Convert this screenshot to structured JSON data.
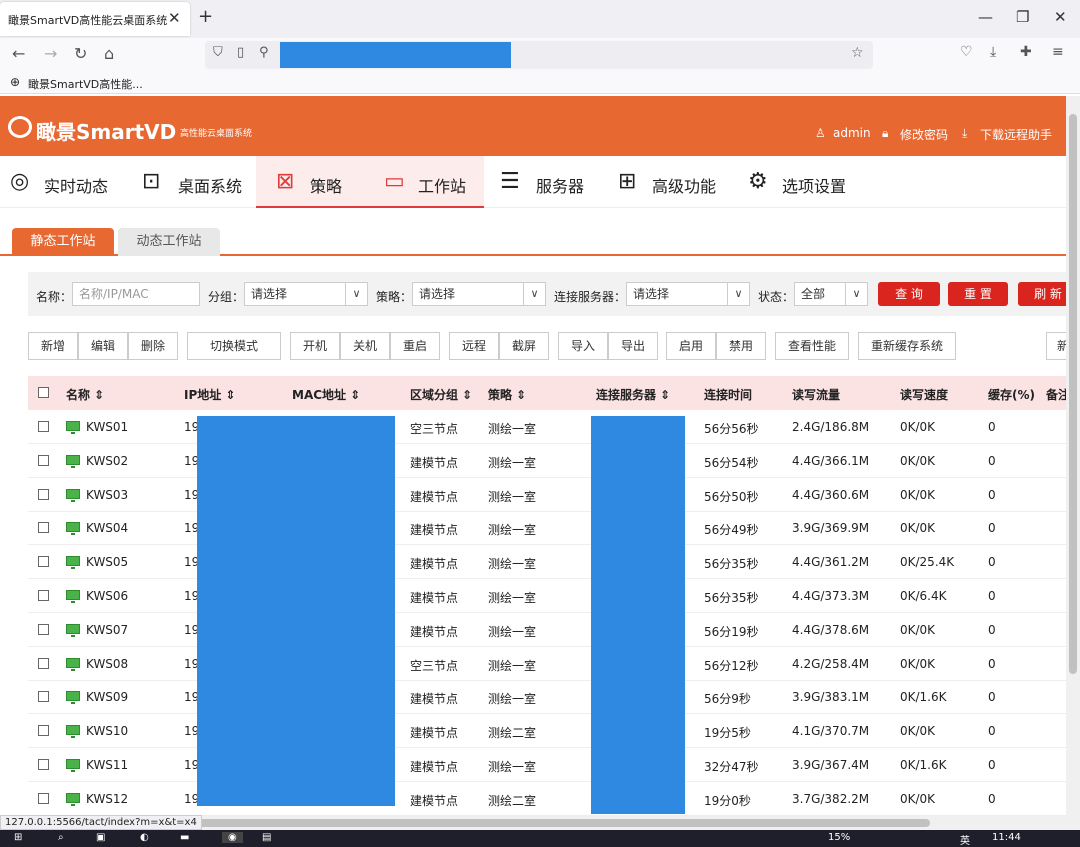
{
  "browser": {
    "tab_title": "瞰景SmartVD高性能云桌面系统",
    "tab_close": "✕",
    "new_tab": "+",
    "bookmark": "瞰景SmartVD高性能...",
    "status_url": "127.0.0.1:5566/tact/index?m=x&t=x4"
  },
  "header": {
    "logo": "瞰景SmartVD",
    "logo_sub": "高性能云桌面系统",
    "user": "admin",
    "change_password": "修改密码",
    "download": "下载远程助手"
  },
  "nav": [
    "实时动态",
    "桌面系统",
    "策略",
    "工作站",
    "服务器",
    "高级功能",
    "选项设置"
  ],
  "subtabs": [
    "静态工作站",
    "动态工作站"
  ],
  "filters": {
    "name_label": "名称：",
    "name_placeholder": "名称/IP/MAC",
    "group_label": "分组：",
    "group_value": "请选择",
    "policy_label": "策略：",
    "policy_value": "请选择",
    "server_label": "连接服务器：",
    "server_value": "请选择",
    "state_label": "状态：",
    "state_value": "全部",
    "query": "查 询",
    "reset": "重 置",
    "refresh": "刷 新"
  },
  "actions": [
    "新增",
    "编辑",
    "删除",
    "切换模式",
    "开机",
    "关机",
    "重启",
    "远程",
    "截屏",
    "导入",
    "导出",
    "启用",
    "禁用",
    "查看性能",
    "重新缓存系统",
    "新"
  ],
  "columns": [
    "名称 ⇕",
    "IP地址 ⇕",
    "MAC地址 ⇕",
    "区域分组 ⇕",
    "策略 ⇕",
    "连接服务器 ⇕",
    "连接时间",
    "读写流量",
    "读写速度",
    "缓存(%)",
    "备注"
  ],
  "rows": [
    {
      "name": "KWS01",
      "ip": "19",
      "group": "空三节点",
      "policy": "测绘一室",
      "time": "56分56秒",
      "traffic": "2.4G/186.8M",
      "speed": "0K/0K",
      "cache": "0"
    },
    {
      "name": "KWS02",
      "ip": "19",
      "group": "建模节点",
      "policy": "测绘一室",
      "time": "56分54秒",
      "traffic": "4.4G/366.1M",
      "speed": "0K/0K",
      "cache": "0"
    },
    {
      "name": "KWS03",
      "ip": "19",
      "group": "建模节点",
      "policy": "测绘一室",
      "time": "56分50秒",
      "traffic": "4.4G/360.6M",
      "speed": "0K/0K",
      "cache": "0"
    },
    {
      "name": "KWS04",
      "ip": "19",
      "group": "建模节点",
      "policy": "测绘一室",
      "time": "56分49秒",
      "traffic": "3.9G/369.9M",
      "speed": "0K/0K",
      "cache": "0"
    },
    {
      "name": "KWS05",
      "ip": "19",
      "group": "建模节点",
      "policy": "测绘一室",
      "time": "56分35秒",
      "traffic": "4.4G/361.2M",
      "speed": "0K/25.4K",
      "cache": "0"
    },
    {
      "name": "KWS06",
      "ip": "19",
      "group": "建模节点",
      "policy": "测绘一室",
      "time": "56分35秒",
      "traffic": "4.4G/373.3M",
      "speed": "0K/6.4K",
      "cache": "0"
    },
    {
      "name": "KWS07",
      "ip": "19",
      "group": "建模节点",
      "policy": "测绘一室",
      "time": "56分19秒",
      "traffic": "4.4G/378.6M",
      "speed": "0K/0K",
      "cache": "0"
    },
    {
      "name": "KWS08",
      "ip": "19",
      "group": "空三节点",
      "policy": "测绘一室",
      "time": "56分12秒",
      "traffic": "4.2G/258.4M",
      "speed": "0K/0K",
      "cache": "0"
    },
    {
      "name": "KWS09",
      "ip": "19",
      "group": "建模节点",
      "policy": "测绘一室",
      "time": "56分9秒",
      "traffic": "3.9G/383.1M",
      "speed": "0K/1.6K",
      "cache": "0"
    },
    {
      "name": "KWS10",
      "ip": "19",
      "group": "建模节点",
      "policy": "测绘二室",
      "time": "19分5秒",
      "traffic": "4.1G/370.7M",
      "speed": "0K/0K",
      "cache": "0"
    },
    {
      "name": "KWS11",
      "ip": "19",
      "group": "建模节点",
      "policy": "测绘一室",
      "time": "32分47秒",
      "traffic": "3.9G/367.4M",
      "speed": "0K/1.6K",
      "cache": "0"
    },
    {
      "name": "KWS12",
      "ip": "19",
      "group": "建模节点",
      "policy": "测绘二室",
      "time": "19分0秒",
      "traffic": "3.7G/382.2M",
      "speed": "0K/0K",
      "cache": "0"
    }
  ],
  "taskbar": {
    "battery": "15%",
    "time": "11:44",
    "lang": "英"
  },
  "colors": {
    "brand": "#e86832",
    "red": "#d9251d",
    "mask": "#2f89e0"
  }
}
